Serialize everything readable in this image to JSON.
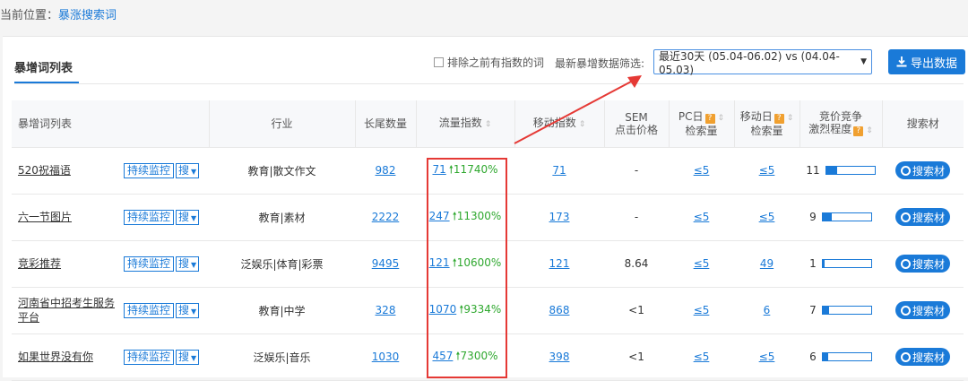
{
  "breadcrumb": {
    "label": "当前位置：",
    "current": "暴涨搜索词"
  },
  "panel": {
    "title": "暴增词列表",
    "filter_checkbox_label": "排除之前有指数的词",
    "filter_label": "最新暴增数据筛选:",
    "select_value": "最近30天 (05.04-06.02) vs (04.04-05.03)",
    "export_label": "导出数据"
  },
  "columns": {
    "keyword": "暴增词列表",
    "industry": "行业",
    "longtail": "长尾数量",
    "traffic": "流量指数",
    "mobile": "移动指数",
    "sem": "SEM点击价格",
    "pc_daily": "PC日检索量",
    "mobile_daily": "移动日检索量",
    "competition": "竞价竞争激烈程度",
    "material": "搜索材"
  },
  "row_actions": {
    "monitor": "持续监控",
    "search": "搜",
    "material_btn": "搜索材"
  },
  "rows": [
    {
      "keyword": "520祝福语",
      "industry": "教育|散文作文",
      "longtail": "982",
      "traffic": "71",
      "growth": "11740%",
      "mobile": "71",
      "sem": "-",
      "pc_daily": "≤5",
      "mobile_daily": "≤5",
      "competition": "11",
      "competition_level": 0.22
    },
    {
      "keyword": "六一节图片",
      "industry": "教育|素材",
      "longtail": "2222",
      "traffic": "247",
      "growth": "11300%",
      "mobile": "173",
      "sem": "-",
      "pc_daily": "≤5",
      "mobile_daily": "≤5",
      "competition": "9",
      "competition_level": 0.18
    },
    {
      "keyword": "竞彩推荐",
      "industry": "泛娱乐|体育|彩票",
      "longtail": "9495",
      "traffic": "121",
      "growth": "10600%",
      "mobile": "121",
      "sem": "8.64",
      "pc_daily": "≤5",
      "mobile_daily": "49",
      "competition": "1",
      "competition_level": 0.03
    },
    {
      "keyword": "河南省中招考生服务平台",
      "industry": "教育|中学",
      "longtail": "328",
      "traffic": "1070",
      "growth": "9334%",
      "mobile": "868",
      "sem": "<1",
      "pc_daily": "≤5",
      "mobile_daily": "6",
      "competition": "7",
      "competition_level": 0.14
    },
    {
      "keyword": "如果世界没有你",
      "industry": "泛娱乐|音乐",
      "longtail": "1030",
      "traffic": "457",
      "growth": "7300%",
      "mobile": "398",
      "sem": "<1",
      "pc_daily": "≤5",
      "mobile_daily": "≤5",
      "competition": "6",
      "competition_level": 0.12
    }
  ],
  "colors": {
    "accent": "#1a7ad8",
    "growth": "#2fa82f",
    "highlight": "#e53935",
    "help": "#f0a030"
  }
}
